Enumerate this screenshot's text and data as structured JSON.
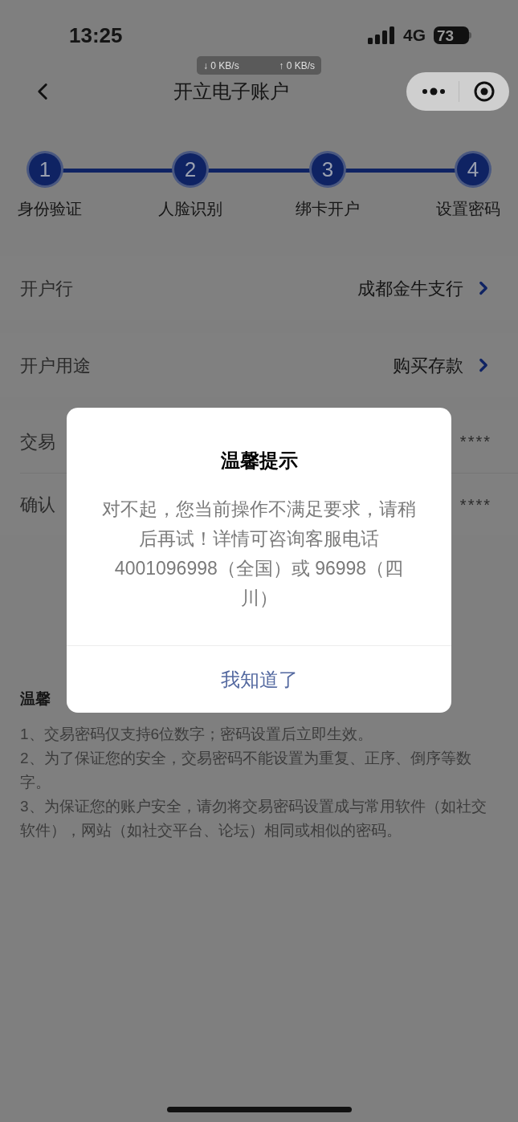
{
  "status_bar": {
    "time": "13:25",
    "network": "4G",
    "battery": "73"
  },
  "net_speed": {
    "down": "↓ 0 KB/s",
    "up": "↑ 0 KB/s"
  },
  "nav": {
    "title": "开立电子账户"
  },
  "steps": [
    {
      "number": "1",
      "label": "身份验证"
    },
    {
      "number": "2",
      "label": "人脸识别"
    },
    {
      "number": "3",
      "label": "绑卡开户"
    },
    {
      "number": "4",
      "label": "设置密码"
    }
  ],
  "form_rows": [
    {
      "kind": "select",
      "label": "开户行",
      "value": "成都金牛支行"
    },
    {
      "kind": "select",
      "label": "开户用途",
      "value": "购买存款"
    },
    {
      "kind": "password",
      "label": "交易",
      "value": "****"
    },
    {
      "kind": "password",
      "label": "确认",
      "value": "****"
    }
  ],
  "notes": {
    "heading": "温馨",
    "lines": [
      "1、交易密码仅支持6位数字；密码设置后立即生效。",
      "2、为了保证您的安全，交易密码不能设置为重复、正序、倒序等数字。",
      "3、为保证您的账户安全，请勿将交易密码设置成与常用软件（如社交软件），网站（如社交平台、论坛）相同或相似的密码。"
    ]
  },
  "dialog": {
    "title": "温馨提示",
    "message": "对不起，您当前操作不满足要求，请稍后再试！详情可咨询客服电话4001096998（全国）或 96998（四川）",
    "button": "我知道了"
  }
}
